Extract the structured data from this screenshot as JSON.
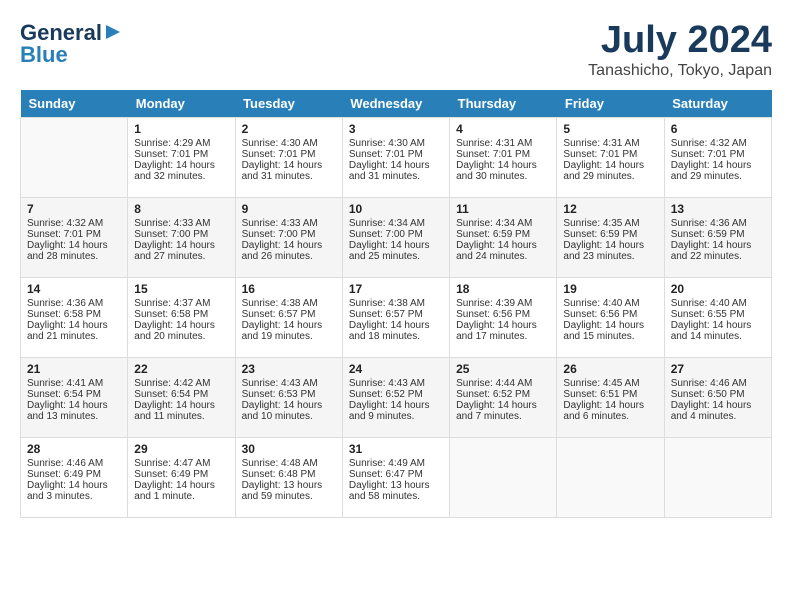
{
  "header": {
    "logo_line1": "General",
    "logo_line2": "Blue",
    "month_year": "July 2024",
    "location": "Tanashicho, Tokyo, Japan"
  },
  "days_of_week": [
    "Sunday",
    "Monday",
    "Tuesday",
    "Wednesday",
    "Thursday",
    "Friday",
    "Saturday"
  ],
  "weeks": [
    [
      {
        "day": "",
        "sunrise": "",
        "sunset": "",
        "daylight": ""
      },
      {
        "day": "1",
        "sunrise": "Sunrise: 4:29 AM",
        "sunset": "Sunset: 7:01 PM",
        "daylight": "Daylight: 14 hours and 32 minutes."
      },
      {
        "day": "2",
        "sunrise": "Sunrise: 4:30 AM",
        "sunset": "Sunset: 7:01 PM",
        "daylight": "Daylight: 14 hours and 31 minutes."
      },
      {
        "day": "3",
        "sunrise": "Sunrise: 4:30 AM",
        "sunset": "Sunset: 7:01 PM",
        "daylight": "Daylight: 14 hours and 31 minutes."
      },
      {
        "day": "4",
        "sunrise": "Sunrise: 4:31 AM",
        "sunset": "Sunset: 7:01 PM",
        "daylight": "Daylight: 14 hours and 30 minutes."
      },
      {
        "day": "5",
        "sunrise": "Sunrise: 4:31 AM",
        "sunset": "Sunset: 7:01 PM",
        "daylight": "Daylight: 14 hours and 29 minutes."
      },
      {
        "day": "6",
        "sunrise": "Sunrise: 4:32 AM",
        "sunset": "Sunset: 7:01 PM",
        "daylight": "Daylight: 14 hours and 29 minutes."
      }
    ],
    [
      {
        "day": "7",
        "sunrise": "Sunrise: 4:32 AM",
        "sunset": "Sunset: 7:01 PM",
        "daylight": "Daylight: 14 hours and 28 minutes."
      },
      {
        "day": "8",
        "sunrise": "Sunrise: 4:33 AM",
        "sunset": "Sunset: 7:00 PM",
        "daylight": "Daylight: 14 hours and 27 minutes."
      },
      {
        "day": "9",
        "sunrise": "Sunrise: 4:33 AM",
        "sunset": "Sunset: 7:00 PM",
        "daylight": "Daylight: 14 hours and 26 minutes."
      },
      {
        "day": "10",
        "sunrise": "Sunrise: 4:34 AM",
        "sunset": "Sunset: 7:00 PM",
        "daylight": "Daylight: 14 hours and 25 minutes."
      },
      {
        "day": "11",
        "sunrise": "Sunrise: 4:34 AM",
        "sunset": "Sunset: 6:59 PM",
        "daylight": "Daylight: 14 hours and 24 minutes."
      },
      {
        "day": "12",
        "sunrise": "Sunrise: 4:35 AM",
        "sunset": "Sunset: 6:59 PM",
        "daylight": "Daylight: 14 hours and 23 minutes."
      },
      {
        "day": "13",
        "sunrise": "Sunrise: 4:36 AM",
        "sunset": "Sunset: 6:59 PM",
        "daylight": "Daylight: 14 hours and 22 minutes."
      }
    ],
    [
      {
        "day": "14",
        "sunrise": "Sunrise: 4:36 AM",
        "sunset": "Sunset: 6:58 PM",
        "daylight": "Daylight: 14 hours and 21 minutes."
      },
      {
        "day": "15",
        "sunrise": "Sunrise: 4:37 AM",
        "sunset": "Sunset: 6:58 PM",
        "daylight": "Daylight: 14 hours and 20 minutes."
      },
      {
        "day": "16",
        "sunrise": "Sunrise: 4:38 AM",
        "sunset": "Sunset: 6:57 PM",
        "daylight": "Daylight: 14 hours and 19 minutes."
      },
      {
        "day": "17",
        "sunrise": "Sunrise: 4:38 AM",
        "sunset": "Sunset: 6:57 PM",
        "daylight": "Daylight: 14 hours and 18 minutes."
      },
      {
        "day": "18",
        "sunrise": "Sunrise: 4:39 AM",
        "sunset": "Sunset: 6:56 PM",
        "daylight": "Daylight: 14 hours and 17 minutes."
      },
      {
        "day": "19",
        "sunrise": "Sunrise: 4:40 AM",
        "sunset": "Sunset: 6:56 PM",
        "daylight": "Daylight: 14 hours and 15 minutes."
      },
      {
        "day": "20",
        "sunrise": "Sunrise: 4:40 AM",
        "sunset": "Sunset: 6:55 PM",
        "daylight": "Daylight: 14 hours and 14 minutes."
      }
    ],
    [
      {
        "day": "21",
        "sunrise": "Sunrise: 4:41 AM",
        "sunset": "Sunset: 6:54 PM",
        "daylight": "Daylight: 14 hours and 13 minutes."
      },
      {
        "day": "22",
        "sunrise": "Sunrise: 4:42 AM",
        "sunset": "Sunset: 6:54 PM",
        "daylight": "Daylight: 14 hours and 11 minutes."
      },
      {
        "day": "23",
        "sunrise": "Sunrise: 4:43 AM",
        "sunset": "Sunset: 6:53 PM",
        "daylight": "Daylight: 14 hours and 10 minutes."
      },
      {
        "day": "24",
        "sunrise": "Sunrise: 4:43 AM",
        "sunset": "Sunset: 6:52 PM",
        "daylight": "Daylight: 14 hours and 9 minutes."
      },
      {
        "day": "25",
        "sunrise": "Sunrise: 4:44 AM",
        "sunset": "Sunset: 6:52 PM",
        "daylight": "Daylight: 14 hours and 7 minutes."
      },
      {
        "day": "26",
        "sunrise": "Sunrise: 4:45 AM",
        "sunset": "Sunset: 6:51 PM",
        "daylight": "Daylight: 14 hours and 6 minutes."
      },
      {
        "day": "27",
        "sunrise": "Sunrise: 4:46 AM",
        "sunset": "Sunset: 6:50 PM",
        "daylight": "Daylight: 14 hours and 4 minutes."
      }
    ],
    [
      {
        "day": "28",
        "sunrise": "Sunrise: 4:46 AM",
        "sunset": "Sunset: 6:49 PM",
        "daylight": "Daylight: 14 hours and 3 minutes."
      },
      {
        "day": "29",
        "sunrise": "Sunrise: 4:47 AM",
        "sunset": "Sunset: 6:49 PM",
        "daylight": "Daylight: 14 hours and 1 minute."
      },
      {
        "day": "30",
        "sunrise": "Sunrise: 4:48 AM",
        "sunset": "Sunset: 6:48 PM",
        "daylight": "Daylight: 13 hours and 59 minutes."
      },
      {
        "day": "31",
        "sunrise": "Sunrise: 4:49 AM",
        "sunset": "Sunset: 6:47 PM",
        "daylight": "Daylight: 13 hours and 58 minutes."
      },
      {
        "day": "",
        "sunrise": "",
        "sunset": "",
        "daylight": ""
      },
      {
        "day": "",
        "sunrise": "",
        "sunset": "",
        "daylight": ""
      },
      {
        "day": "",
        "sunrise": "",
        "sunset": "",
        "daylight": ""
      }
    ]
  ]
}
